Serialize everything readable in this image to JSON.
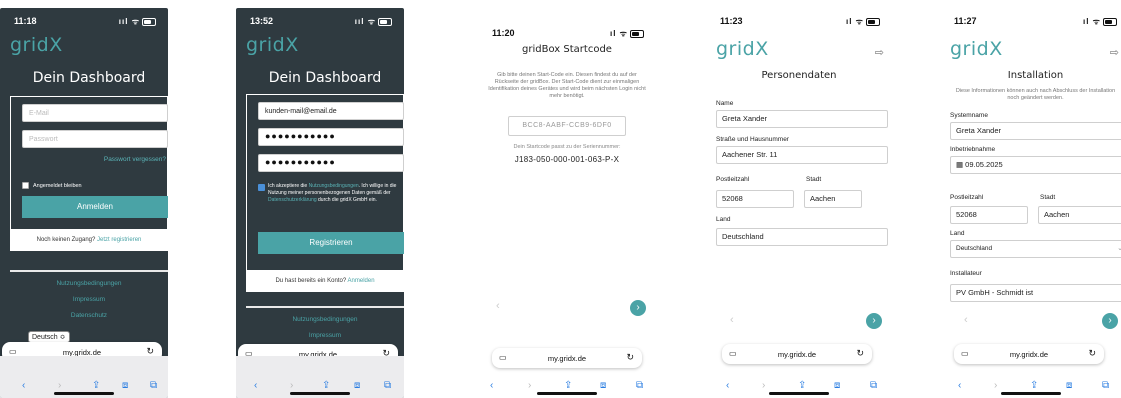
{
  "screens": [
    {
      "time": "11:18",
      "logo": "gridX",
      "title": "Dein Dashboard",
      "email_placeholder": "E-Mail",
      "password_placeholder": "Passwort",
      "forgot": "Passwort vergessen?",
      "remember": "Angemeldet bleiben",
      "login_button": "Anmelden",
      "no_access": "Noch keinen Zugang?",
      "register_link": "Jetzt registrieren",
      "footer": [
        "Nutzungsbedingungen",
        "Impressum",
        "Datenschutz"
      ],
      "language": "Deutsch ≎",
      "url": "my.gridx.de"
    },
    {
      "time": "13:52",
      "logo": "gridX",
      "title": "Dein Dashboard",
      "email_value": "kunden-mail@email.de",
      "password1": "●●●●●●●●●●●",
      "password2": "●●●●●●●●●●●",
      "consent_pre": "Ich akzeptiere die ",
      "consent_link1": "Nutzungsbedingungen",
      "consent_mid": ". Ich willige in die Nutzung meiner personenbezogenen Daten gemäß der ",
      "consent_link2": "Datenschutzerklärung",
      "consent_post": " durch die gridX GmbH ein.",
      "register_button": "Registrieren",
      "has_account": "Du hast bereits ein Konto?",
      "login_link": "Anmelden",
      "footer": [
        "Nutzungsbedingungen",
        "Impressum"
      ],
      "url": "my.gridx.de"
    },
    {
      "time": "11:20",
      "title": "gridBox Startcode",
      "description": "Gib bitte deinen Start-Code ein. Diesen findest du auf der Rückseite der gridBox. Der Start-Code dient zur einmaligen Identifikation deines Gerätes und wird beim nächsten Login nicht mehr benötigt.",
      "code_value": "BCC8-AABF-CCB9-6DF0",
      "serial_label": "Dein Startcode passt zu der Seriennummer:",
      "serial_value": "J183-050-000-001-063-P-X",
      "url": "my.gridx.de"
    },
    {
      "time": "11:23",
      "logo": "gridX",
      "title": "Personendaten",
      "name_label": "Name",
      "name_value": "Greta Xander",
      "street_label": "Straße und Hausnummer",
      "street_value": "Aachener Str. 11",
      "zip_label": "Postleitzahl",
      "zip_value": "52068",
      "city_label": "Stadt",
      "city_value": "Aachen",
      "country_label": "Land",
      "country_value": "Deutschland",
      "url": "my.gridx.de"
    },
    {
      "time": "11:27",
      "logo": "gridX",
      "title": "Installation",
      "description": "Diese Informationen können auch nach Abschluss der Installation noch geändert werden.",
      "system_label": "Systemname",
      "system_value": "Greta Xander",
      "date_label": "Inbetriebnahme",
      "date_value": "09.05.2025",
      "zip_label": "Postleitzahl",
      "zip_value": "52068",
      "city_label": "Stadt",
      "city_value": "Aachen",
      "country_label": "Land",
      "country_value": "Deutschland",
      "installer_label": "Installateur",
      "installer_value": "PV GmbH - Schmidt ist",
      "url": "my.gridx.de"
    }
  ],
  "icons": {
    "logout": "logout-icon",
    "calendar": "calendar-icon",
    "back": "back-arrow-icon",
    "next": "next-arrow-icon"
  }
}
